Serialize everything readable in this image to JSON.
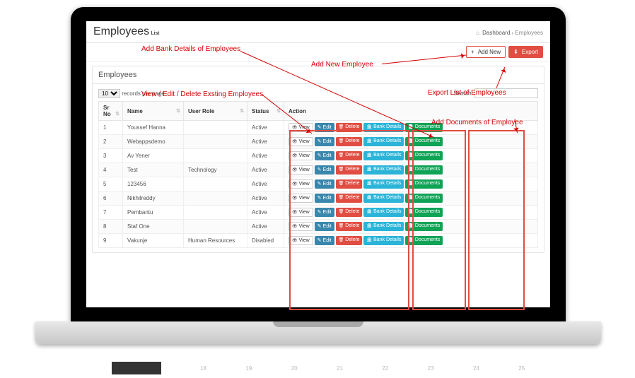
{
  "header": {
    "title": "Employees",
    "subtitle": "List",
    "breadcrumb_home": "Dashboard",
    "breadcrumb_current": "Employees"
  },
  "toolbar": {
    "add_new": "Add New",
    "export": "Export"
  },
  "panel": {
    "title": "Employees"
  },
  "datatable": {
    "length_prefix": "",
    "length_value": "10",
    "length_suffix": "records per page",
    "search_label": "Search:"
  },
  "columns": {
    "srno": "Sr No",
    "name": "Name",
    "role": "User Role",
    "status": "Status",
    "action": "Action"
  },
  "action_labels": {
    "view": "View",
    "edit": "Edit",
    "delete": "Delete",
    "bank": "Bank Details",
    "docs": "Documents"
  },
  "rows": [
    {
      "sr": "1",
      "name": "Youssef Hanna",
      "role": "",
      "status": "Active"
    },
    {
      "sr": "2",
      "name": "Webappsdemo",
      "role": "",
      "status": "Active"
    },
    {
      "sr": "3",
      "name": "Av Yener",
      "role": "",
      "status": "Active"
    },
    {
      "sr": "4",
      "name": "Test",
      "role": "Technology",
      "status": "Active"
    },
    {
      "sr": "5",
      "name": "123456",
      "role": "",
      "status": "Active"
    },
    {
      "sr": "6",
      "name": "Nikhilreddy",
      "role": "",
      "status": "Active"
    },
    {
      "sr": "7",
      "name": "Pembantu",
      "role": "",
      "status": "Active"
    },
    {
      "sr": "8",
      "name": "Staf One",
      "role": "",
      "status": "Active"
    },
    {
      "sr": "9",
      "name": "Vakunje",
      "role": "Human Resources",
      "status": "Disabled"
    }
  ],
  "annotations": {
    "bank": "Add Bank Details of Employees",
    "add_new": "Add New Employee",
    "view_edit": "View / Edit / Delete Exsting Employees",
    "export": "Export List of Employees",
    "docs": "Add Documents of Employee"
  },
  "ghost_numbers": [
    "18",
    "19",
    "20",
    "21",
    "22",
    "23",
    "24",
    "25"
  ]
}
